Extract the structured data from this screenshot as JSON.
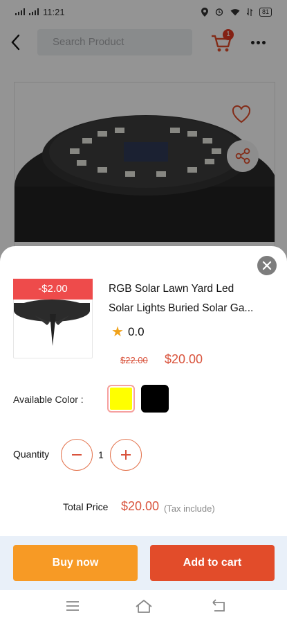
{
  "status_bar": {
    "time": "11:21",
    "battery": "81"
  },
  "header": {
    "search_placeholder": "Search Product",
    "cart_count": "1"
  },
  "product_page": {
    "icons": [
      "back-arrow-icon",
      "cart-icon",
      "more-dots-icon",
      "heart-icon",
      "share-icon"
    ]
  },
  "sheet": {
    "discount": "-$2.00",
    "title_line1": "RGB Solar Lawn Yard Led",
    "title_line2": "Solar Lights Buried Solar Ga...",
    "rating": "0.0",
    "old_price": "$22.00",
    "price": "$20.00",
    "color_label": "Available Color :",
    "colors": [
      {
        "name": "yellow",
        "hex": "#ffff00",
        "selected": true
      },
      {
        "name": "black",
        "hex": "#000000",
        "selected": false
      }
    ],
    "quantity_label": "Quantity",
    "quantity": "1",
    "total_label": "Total Price",
    "total_price": "$20.00",
    "tax_note": "(Tax include)",
    "buy_now": "Buy now",
    "add_to_cart": "Add to cart"
  },
  "theme": {
    "accent": "#e24c2a",
    "buy_color": "#f79a25",
    "price_color": "#d9533c"
  }
}
